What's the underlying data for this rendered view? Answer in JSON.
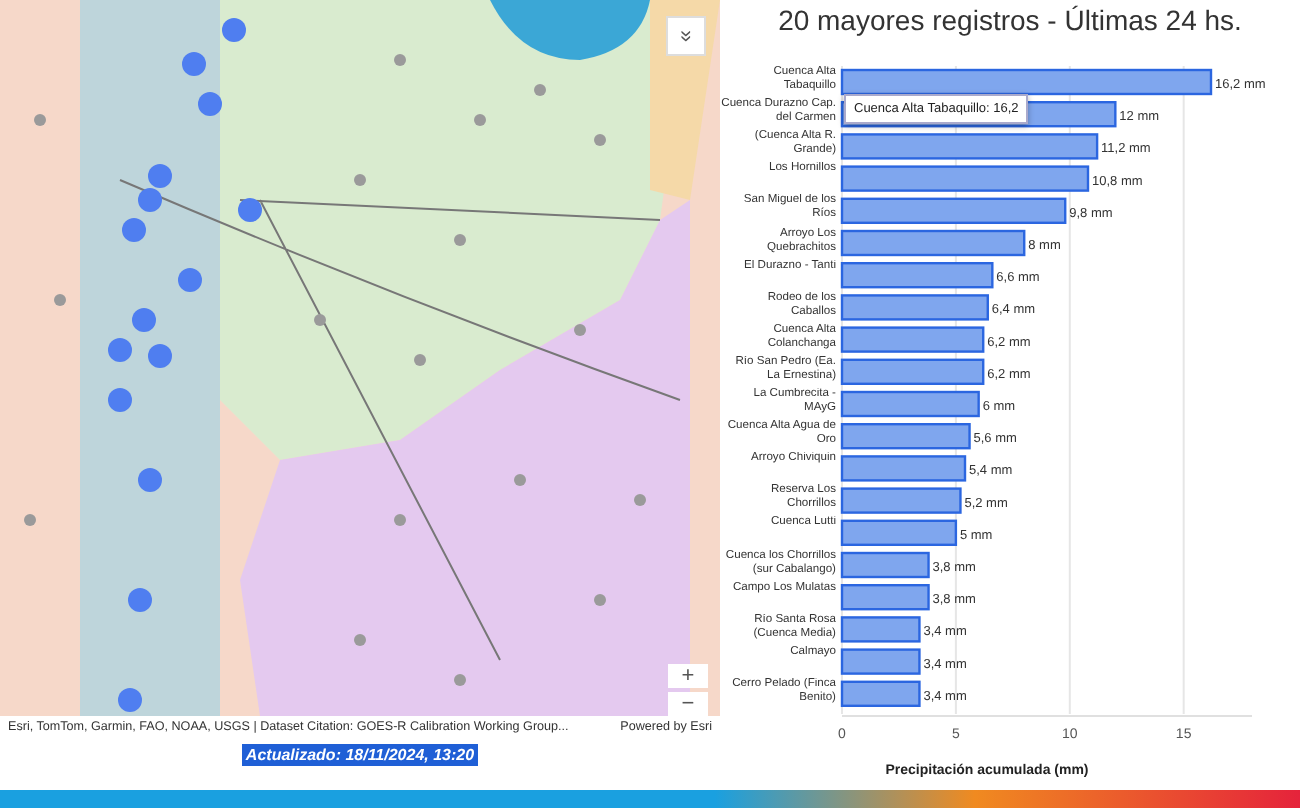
{
  "map": {
    "collapse_button": "»",
    "zoom_in": "+",
    "zoom_out": "−",
    "attribution": "Esri, TomTom, Garmin, FAO, NOAA, USGS | Dataset Citation: GOES-R Calibration Working Group...",
    "powered_by": "Powered by Esri",
    "updated": "Actualizado: 18/11/2024, 13:20"
  },
  "chart": {
    "tooltip": "Cuenca Alta Tabaquillo: 16,2",
    "chart_data": {
      "type": "bar",
      "orientation": "horizontal",
      "title": "20 mayores registros - Últimas 24 hs.",
      "xlabel": "Precipitación acumulada (mm)",
      "categories": [
        "Cuenca Alta Tabaquillo",
        "Cuenca Durazno Cap. del Carmen",
        "(Cuenca Alta R. Grande)",
        "Los Hornillos",
        "San Miguel de los Ríos",
        "Arroyo Los Quebrachitos",
        "El Durazno - Tanti",
        "Rodeo de los Caballos",
        "Cuenca Alta Colanchanga",
        "Río San Pedro (Ea. La Ernestina)",
        "La Cumbrecita - MAyG",
        "Cuenca Alta Agua de Oro",
        "Arroyo Chiviquin",
        "Reserva Los Chorrillos",
        "Cuenca Lutti",
        "Cuenca los Chorrillos (sur Cabalango)",
        "Campo Los Mulatas",
        "Río Santa Rosa (Cuenca Media)",
        "Calmayo",
        "Cerro Pelado (Finca Benito)"
      ],
      "values": [
        16.2,
        12,
        11.2,
        10.8,
        9.8,
        8,
        6.6,
        6.4,
        6.2,
        6.2,
        6,
        5.6,
        5.4,
        5.2,
        5,
        3.8,
        3.8,
        3.4,
        3.4,
        3.4
      ],
      "value_labels": [
        "16,2 mm",
        "12 mm",
        "11,2 mm",
        "10,8 mm",
        "9,8 mm",
        "8 mm",
        "6,6 mm",
        "6,4 mm",
        "6,2 mm",
        "6,2 mm",
        "6 mm",
        "5,6 mm",
        "5,4 mm",
        "5,2 mm",
        "5 mm",
        "3,8 mm",
        "3,8 mm",
        "3,4 mm",
        "3,4 mm",
        "3,4 mm"
      ],
      "xlim": [
        0,
        18
      ],
      "xticks": [
        0,
        5,
        10,
        15
      ],
      "grid": true
    }
  }
}
